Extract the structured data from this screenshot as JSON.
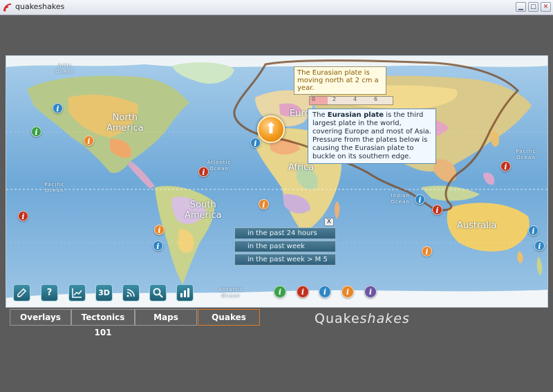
{
  "window": {
    "title": "quakeshakes"
  },
  "map": {
    "oceans": {
      "arctic": "Artic\nOcean",
      "atlantic": "Atlantic\nOcean",
      "pacific_w": "Pacific\nOcean",
      "pacific_e": "Pacific\nOcean",
      "indian": "Indian\nOcean",
      "antarctic": "Antartic\nOcean"
    },
    "continents": {
      "north_america": "North\nAmerica",
      "south_america": "South\nAmerica",
      "africa": "Africa",
      "australia": "Australia",
      "europe": "Euro"
    },
    "callout": "The Eurasian plate is moving north at 2 cm a year.",
    "ruler": {
      "labels": [
        "0",
        "2",
        "4",
        "6"
      ]
    },
    "popup": {
      "bold": "Eurasian plate",
      "pre": "The ",
      "post": " is the third largest plate in the world, covering Europe and most of Asia. Pressure from the plates below is causing the Eurasian plate to buckle on its southern edge."
    },
    "quake_menu": {
      "items": [
        "in the past 24 hours",
        "in the past week",
        "in the past week > M 5"
      ],
      "close": "X"
    },
    "toolbar": {
      "buttons": [
        "overlay-tool",
        "help",
        "graph",
        "3D",
        "feed",
        "search",
        "chart"
      ],
      "labels": {
        "help": "?",
        "three_d": "3D"
      }
    },
    "legend_info_colors": [
      "#3aa04a",
      "#c0321e",
      "#2f86c4",
      "#e8862a",
      "#6a56a0"
    ]
  },
  "tabs": [
    {
      "label": "Overlays"
    },
    {
      "label": "Tectonics 101"
    },
    {
      "label": "Maps"
    },
    {
      "label": "Quakes",
      "active": true
    }
  ],
  "brand": {
    "part1": "Quake",
    "part2": "shakes"
  },
  "colors": {
    "accent": "#e07b26",
    "ocean": "#7fb6df",
    "panel": "#5b5b5b"
  }
}
